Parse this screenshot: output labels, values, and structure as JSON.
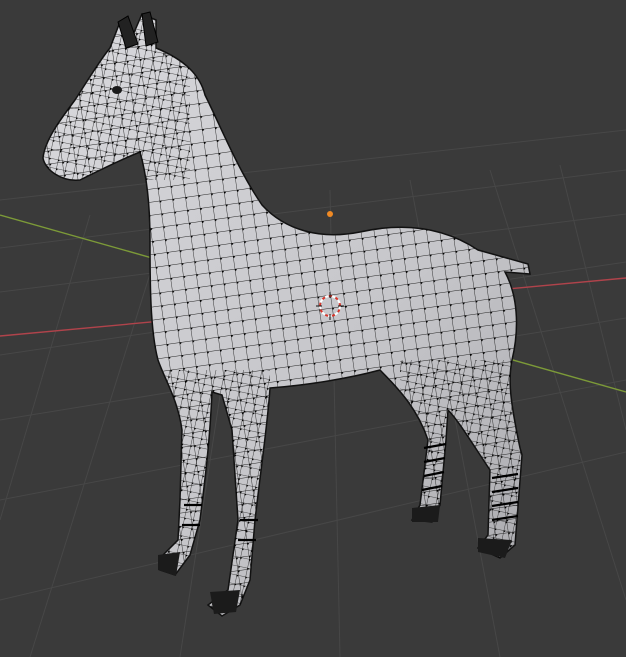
{
  "viewport": {
    "background": "#3a3a3a",
    "grid_color": "#4a4a4a",
    "x_axis_color": "#b0434b",
    "y_axis_color": "#7c9a38"
  },
  "mesh": {
    "object": "horse",
    "display": "wireframe-edit-mode",
    "surface_color": "#c8c8cc",
    "vertex_color": "#000000",
    "edge_color": "#202020"
  },
  "scene_markers": {
    "origin_dot_color": "#f08a24",
    "cursor_ring_color": "#ffffff",
    "cursor_dash_color": "#d8352a"
  }
}
